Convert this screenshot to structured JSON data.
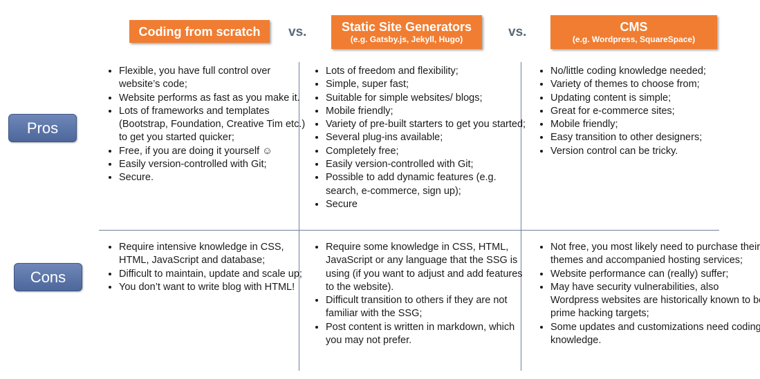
{
  "headers": [
    {
      "title": "Coding from scratch",
      "subtitle": ""
    },
    {
      "title": "Static Site Generators",
      "subtitle": "(e.g. Gatsby.js, Jekyll, Hugo)"
    },
    {
      "title": "CMS",
      "subtitle": "(e.g. Wordpress, SquareSpace)"
    }
  ],
  "vs_label": "vs.",
  "row_labels": {
    "pros": "Pros",
    "cons": "Cons"
  },
  "colors": {
    "header": "#f07d32",
    "row_label": "#5b73a8",
    "divider": "#6f7f9a"
  },
  "pros": [
    [
      "Flexible, you have full control over website’s code;",
      "Website performs as fast as you make it.",
      "Lots of frameworks and templates (Bootstrap, Foundation, Creative Tim etc.) to get you started quicker;",
      "Free, if you are doing it yourself ☺",
      "Easily version-controlled with Git;",
      "Secure."
    ],
    [
      "Lots of freedom and flexibility;",
      "Simple, super fast;",
      "Suitable for simple websites/ blogs;",
      "Mobile friendly;",
      "Variety of pre-built starters to get you started;",
      "Several plug-ins available;",
      "Completely free;",
      "Easily version-controlled with Git;",
      "Possible to add dynamic features (e.g. search, e-commerce, sign up);",
      "Secure"
    ],
    [
      "No/little coding knowledge needed;",
      "Variety of themes to choose from;",
      "Updating content is simple;",
      "Great for e-commerce sites;",
      "Mobile friendly;",
      "Easy transition to other designers;",
      "Version control can be tricky."
    ]
  ],
  "cons": [
    [
      "Require intensive knowledge in CSS, HTML, JavaScript and database;",
      "Difficult to maintain, update and scale up;",
      "You don’t want to write blog with HTML!"
    ],
    [
      "Require some knowledge in CSS, HTML, JavaScript or any language that the SSG is using (if you want to adjust and add features to the website).",
      "Difficult transition to others if they are not familiar with the SSG;",
      "Post content is written in markdown, which you may not prefer."
    ],
    [
      "Not free, you most likely need to purchase their themes and accompanied hosting services;",
      "Website performance can (really) suffer;",
      "May have security vulnerabilities, also Wordpress websites are historically known to be prime hacking targets;",
      "Some updates and customizations need coding knowledge."
    ]
  ]
}
